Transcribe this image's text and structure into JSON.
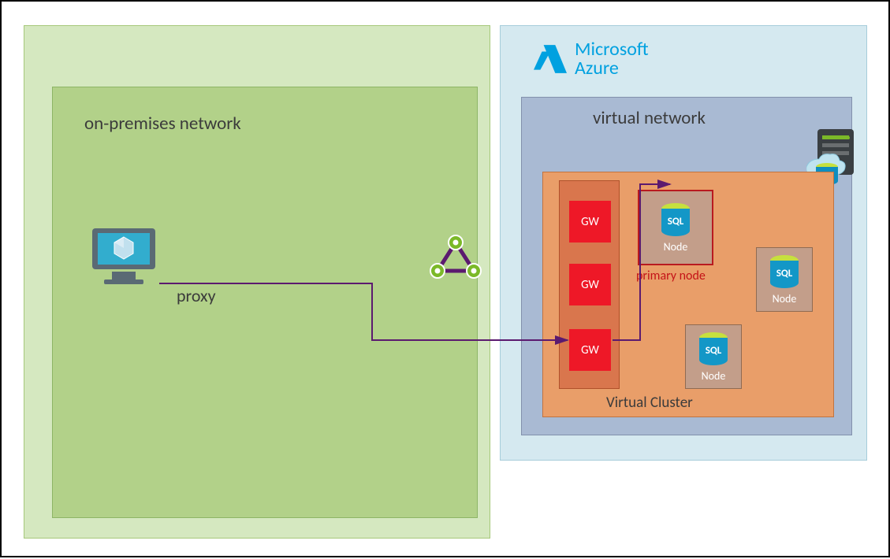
{
  "onprem": {
    "label": "on-premises network",
    "proxy_label": "proxy"
  },
  "azure": {
    "brand_line1": "Microsoft",
    "brand_line2": "Azure",
    "vnet_label": "virtual network",
    "cluster_label": "Virtual Cluster",
    "gw_label": "GW",
    "primary_label": "primary node",
    "node_label": "Node",
    "sql_label": "SQL"
  },
  "colors": {
    "arrow": "#5b1a6f",
    "gw_red": "#ee1827",
    "azure_blue": "#00a1e0",
    "green_dot": "#7bb928"
  }
}
